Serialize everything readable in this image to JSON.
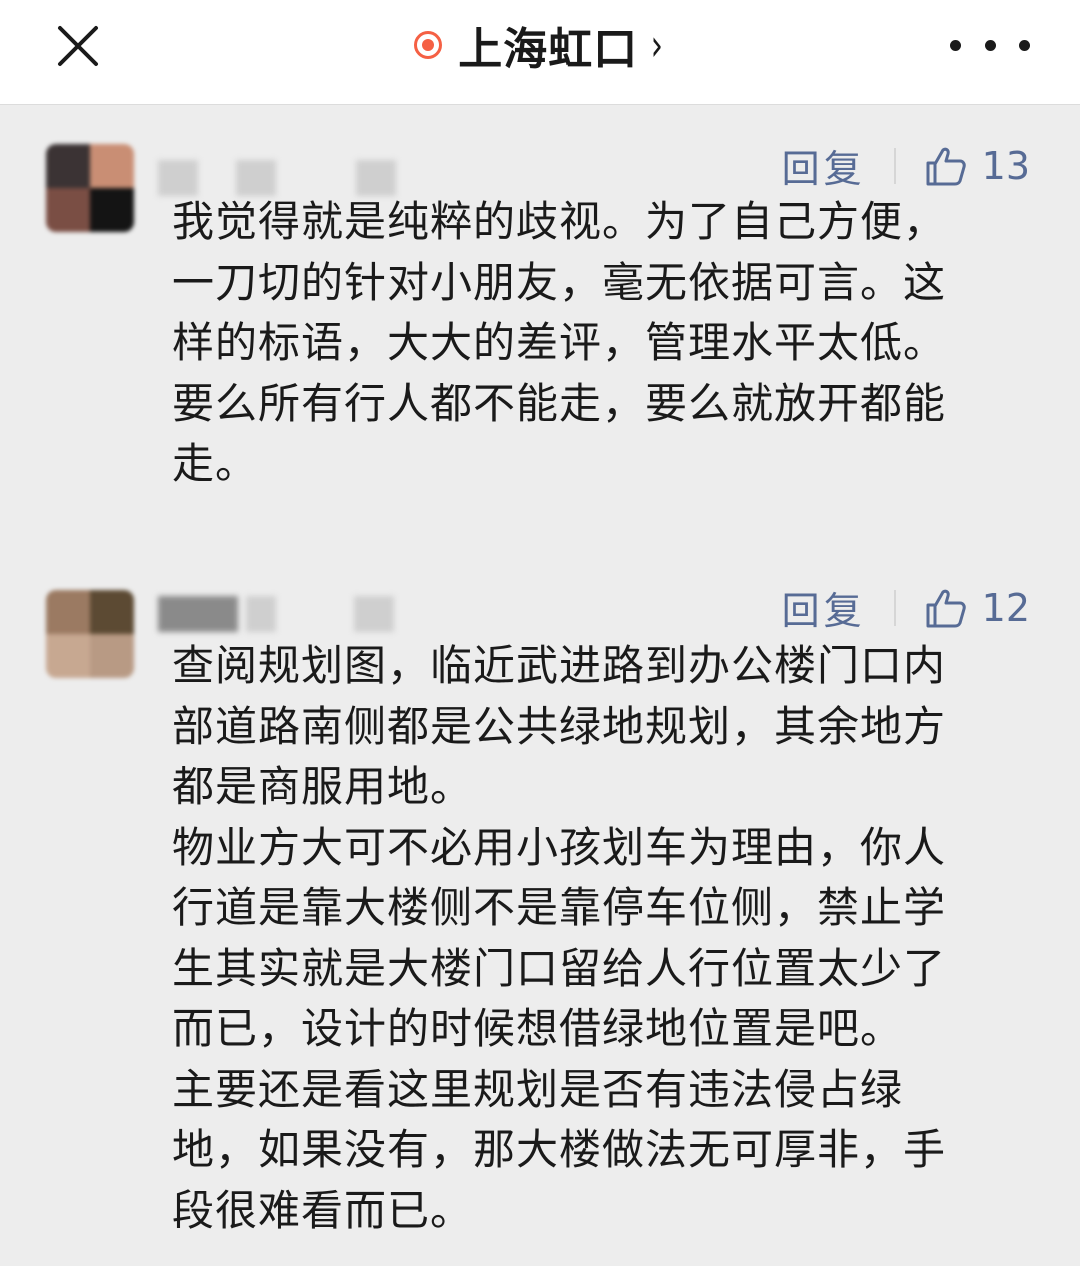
{
  "header": {
    "title": "上海虹口",
    "chevron": "›",
    "icons": {
      "close": "close-icon",
      "live": "live-dot-icon",
      "more": "more-icon"
    }
  },
  "colors": {
    "accent": "#576b95",
    "live_dot": "#f56044",
    "background": "#ededed"
  },
  "comments": [
    {
      "reply_label": "回复",
      "likes": "13",
      "text": "我觉得就是纯粹的歧视。为了自己方便，\n一刀切的针对小朋友，毫无依据可言。这\n样的标语，大大的差评，管理水平太低。\n要么所有行人都不能走，要么就放开都能\n走。"
    },
    {
      "reply_label": "回复",
      "likes": "12",
      "text": "查阅规划图，临近武进路到办公楼门口内\n部道路南侧都是公共绿地规划，其余地方\n都是商服用地。\n物业方大可不必用小孩划车为理由，你人\n行道是靠大楼侧不是靠停车位侧，禁止学\n生其实就是大楼门口留给人行位置太少了\n而已，设计的时候想借绿地位置是吧。\n主要还是看这里规划是否有违法侵占绿\n地，如果没有，那大楼做法无可厚非，手\n段很难看而已。"
    }
  ]
}
